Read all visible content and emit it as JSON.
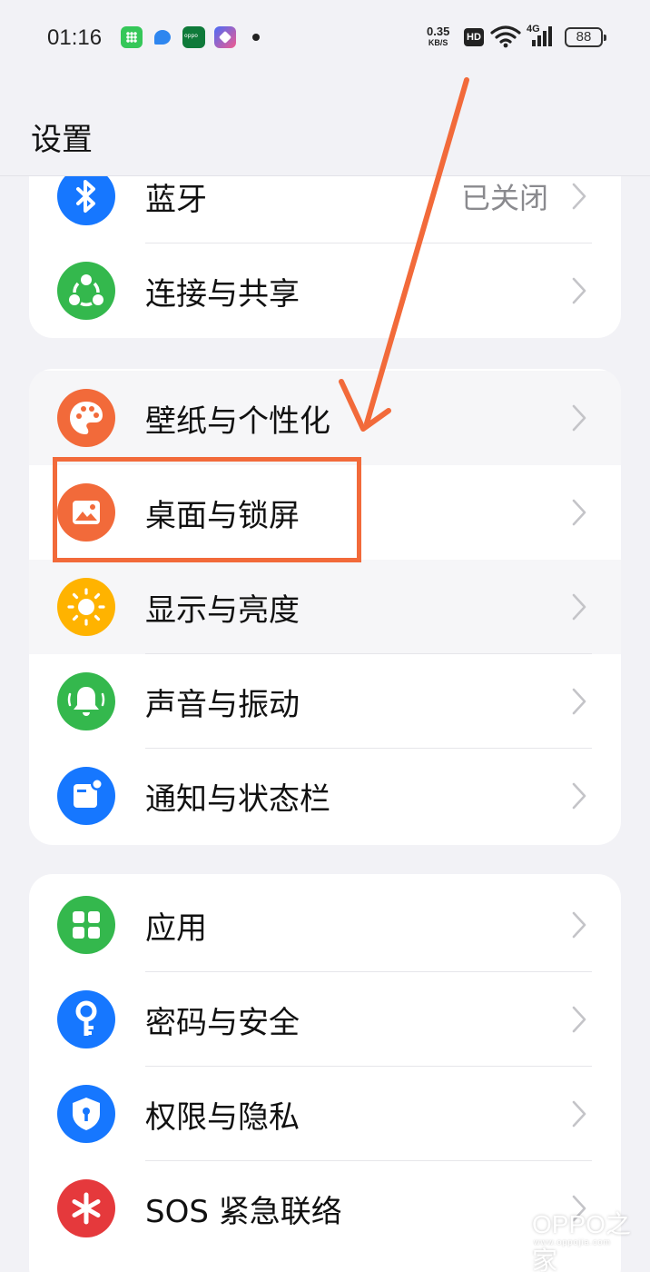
{
  "status_bar": {
    "time": "01:16",
    "net_speed": "0.35",
    "net_speed_unit": "KB/S",
    "hd": "HD",
    "network": "4G",
    "battery": "88"
  },
  "header": {
    "title": "设置"
  },
  "groups": [
    {
      "items": [
        {
          "label": "蓝牙",
          "value": "已关闭",
          "icon": "bluetooth-icon",
          "color": "#1677ff"
        },
        {
          "label": "连接与共享",
          "icon": "share-icon",
          "color": "#34b84d"
        }
      ]
    },
    {
      "items": [
        {
          "label": "壁纸与个性化",
          "icon": "palette-icon",
          "color": "#f26a3a"
        },
        {
          "label": "桌面与锁屏",
          "icon": "image-icon",
          "color": "#f26a3a"
        },
        {
          "label": "显示与亮度",
          "icon": "sun-icon",
          "color": "#ffb300"
        },
        {
          "label": "声音与振动",
          "icon": "bell-icon",
          "color": "#34b84d"
        },
        {
          "label": "通知与状态栏",
          "icon": "notification-icon",
          "color": "#1677ff"
        }
      ]
    },
    {
      "items": [
        {
          "label": "应用",
          "icon": "apps-grid-icon",
          "color": "#34b84d"
        },
        {
          "label": "密码与安全",
          "icon": "key-icon",
          "color": "#1677ff"
        },
        {
          "label": "权限与隐私",
          "icon": "shield-icon",
          "color": "#1677ff"
        },
        {
          "label": "SOS 紧急联络",
          "icon": "sos-asterisk-icon",
          "color": "#e5393c"
        }
      ]
    }
  ],
  "annotation": {
    "color": "#f26a3a"
  },
  "watermark": {
    "text": "OPPO之家",
    "sub": "www.oppojia.com"
  }
}
